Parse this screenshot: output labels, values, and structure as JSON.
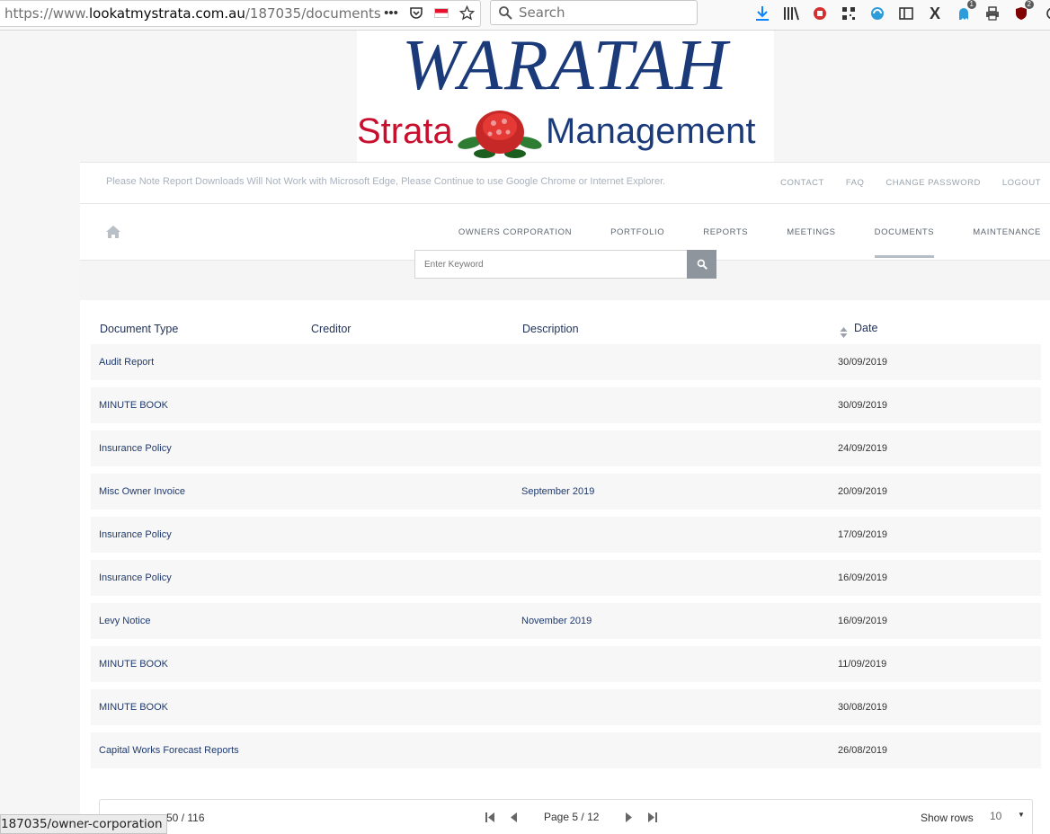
{
  "browser": {
    "url_prefix": "https://www.",
    "url_domain": "lookatmystrata.com.au",
    "url_path": "/187035/documents",
    "search_placeholder": "Search",
    "status_url": "187035/owner-corporation",
    "badges": {
      "notifications": "1",
      "ublock": "2"
    }
  },
  "logo": {
    "title": "WARATAH",
    "strata": "Strata",
    "management": "Management"
  },
  "notice": {
    "text": "Please Note Report Downloads Will Not Work with Microsoft Edge, Please Continue to use Google Chrome or Internet Explorer."
  },
  "top_links": [
    "CONTACT",
    "FAQ",
    "CHANGE PASSWORD",
    "LOGOUT"
  ],
  "nav": {
    "items": [
      "OWNERS CORPORATION",
      "PORTFOLIO",
      "REPORTS",
      "MEETINGS",
      "DOCUMENTS",
      "MAINTENANCE"
    ],
    "active": "DOCUMENTS"
  },
  "search": {
    "placeholder": "Enter Keyword"
  },
  "table": {
    "headers": {
      "type": "Document Type",
      "creditor": "Creditor",
      "description": "Description",
      "date": "Date"
    },
    "rows": [
      {
        "type": "Audit Report",
        "creditor": "",
        "description": "",
        "date": "30/09/2019"
      },
      {
        "type": "MINUTE BOOK",
        "creditor": "",
        "description": "",
        "date": "30/09/2019"
      },
      {
        "type": "Insurance Policy",
        "creditor": "",
        "description": "",
        "date": "24/09/2019"
      },
      {
        "type": "Misc Owner Invoice",
        "creditor": "",
        "description": "September 2019",
        "date": "20/09/2019"
      },
      {
        "type": "Insurance Policy",
        "creditor": "",
        "description": "",
        "date": "17/09/2019"
      },
      {
        "type": "Insurance Policy",
        "creditor": "",
        "description": "",
        "date": "16/09/2019"
      },
      {
        "type": "Levy Notice",
        "creditor": "",
        "description": "November 2019",
        "date": "16/09/2019"
      },
      {
        "type": "MINUTE BOOK",
        "creditor": "",
        "description": "",
        "date": "11/09/2019"
      },
      {
        "type": "MINUTE BOOK",
        "creditor": "",
        "description": "",
        "date": "30/08/2019"
      },
      {
        "type": "Capital Works Forecast Reports",
        "creditor": "",
        "description": "",
        "date": "26/08/2019"
      }
    ]
  },
  "pagination": {
    "range_end": "50",
    "range_sep": "/",
    "total": "116",
    "page_label": "Page",
    "current_page": "5",
    "total_pages": "12",
    "rows_label": "Show rows",
    "rows_value": "10"
  },
  "colors": {
    "brand_blue": "#1a3a7a",
    "brand_red": "#c8102e",
    "row_bg": "#f7f7f7",
    "search_button": "#8e959c"
  }
}
